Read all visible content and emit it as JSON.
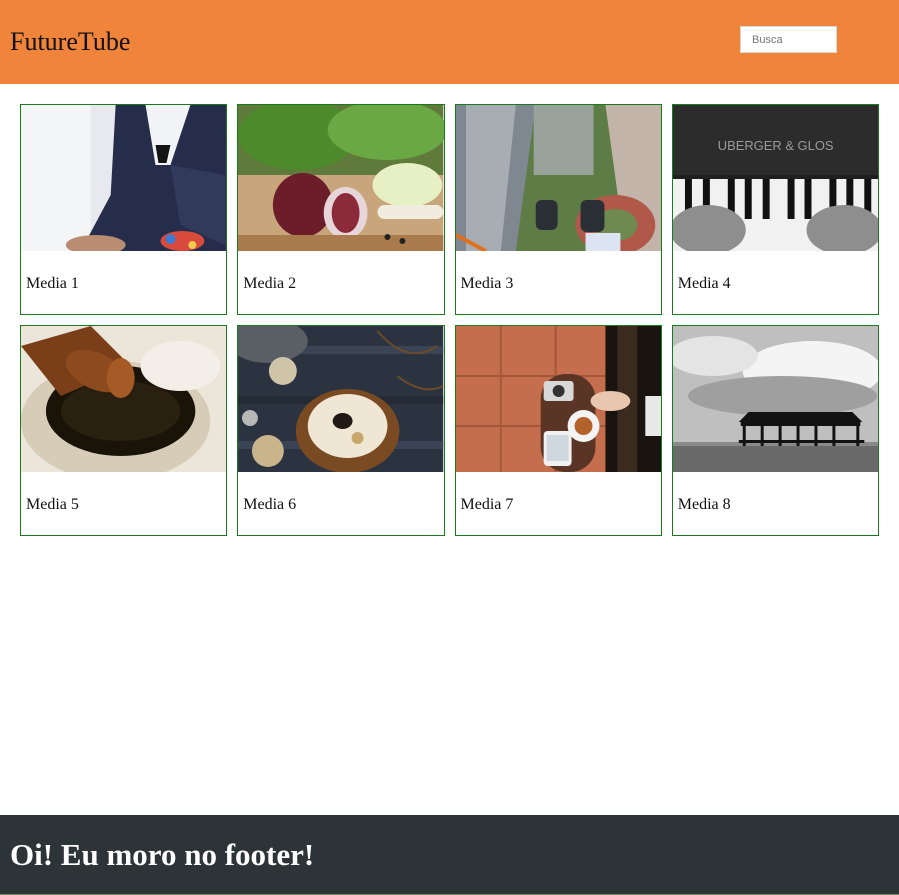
{
  "header": {
    "logo": "FutureTube",
    "search_placeholder": "Busca"
  },
  "media": [
    {
      "title": "Media 1",
      "image": "man-in-suit-photo"
    },
    {
      "title": "Media 2",
      "image": "onion-vegetables-photo"
    },
    {
      "title": "Media 3",
      "image": "feet-over-city-photo"
    },
    {
      "title": "Media 4",
      "image": "piano-keys-photo"
    },
    {
      "title": "Media 5",
      "image": "honey-dipper-photo"
    },
    {
      "title": "Media 6",
      "image": "cake-table-photo"
    },
    {
      "title": "Media 7",
      "image": "coffee-camera-phone-photo"
    },
    {
      "title": "Media 8",
      "image": "pier-seascape-photo"
    }
  ],
  "footer": {
    "text": "Oi! Eu moro no footer!"
  },
  "colors": {
    "header": "#f0843b",
    "card_border": "#1b7a1b",
    "footer": "#2d3438"
  }
}
